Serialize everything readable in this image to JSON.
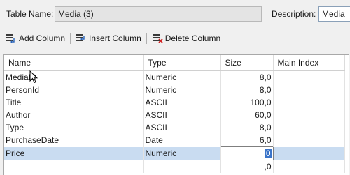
{
  "header": {
    "table_name_label": "Table Name:",
    "table_name_value": "Media (3)",
    "description_label": "Description:",
    "description_value": "Media"
  },
  "toolbar": {
    "add_column": "Add Column",
    "insert_column": "Insert Column",
    "delete_column": "Delete Column"
  },
  "grid": {
    "columns": [
      "Name",
      "Type",
      "Size",
      "Main Index"
    ],
    "rows": [
      {
        "name": "MediaID",
        "type": "Numeric",
        "size": "8,0",
        "index": ""
      },
      {
        "name": "PersonId",
        "type": "Numeric",
        "size": "8,0",
        "index": ""
      },
      {
        "name": "Title",
        "type": "ASCII",
        "size": "100,0",
        "index": ""
      },
      {
        "name": "Author",
        "type": "ASCII",
        "size": "60,0",
        "index": ""
      },
      {
        "name": "Type",
        "type": "ASCII",
        "size": "8,0",
        "index": ""
      },
      {
        "name": "PurchaseDate",
        "type": "Date",
        "size": "6,0",
        "index": ""
      },
      {
        "name": "Price",
        "type": "Numeric",
        "size_edit_highlight": "0",
        "index": ""
      },
      {
        "name": "",
        "type": "",
        "size": ",0",
        "index": ""
      }
    ]
  },
  "icons": {
    "add_column": "add-column-icon",
    "insert_column": "insert-column-icon",
    "delete_column": "delete-column-icon",
    "cursor": "mouse-pointer-icon"
  },
  "colors": {
    "selected_row": "#c9dcf1",
    "caret_highlight": "#3a74c9",
    "delete_red": "#d22020"
  }
}
